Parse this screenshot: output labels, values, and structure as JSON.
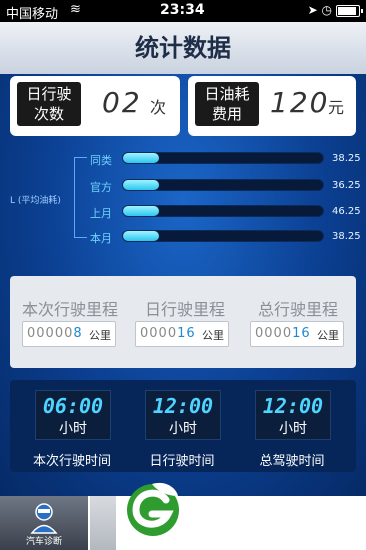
{
  "status_bar": {
    "carrier": "中国移动",
    "time": "23:34"
  },
  "title": "统计数据",
  "cards": {
    "daily_trips": {
      "label_line1": "日行驶",
      "label_line2": "次数",
      "value": "02",
      "unit": "次"
    },
    "daily_fuel": {
      "label_line1": "日油耗",
      "label_line2": "费用",
      "value": "120",
      "unit": "元"
    }
  },
  "fuel_chart": {
    "axis_label": "L (平均油耗)",
    "bars": [
      {
        "label": "同类",
        "value": "38.25",
        "fill": 0.18
      },
      {
        "label": "官方",
        "value": "36.25",
        "fill": 0.18
      },
      {
        "label": "上月",
        "value": "46.25",
        "fill": 0.18
      },
      {
        "label": "本月",
        "value": "38.25",
        "fill": 0.18
      }
    ]
  },
  "mileage": {
    "unit": "公里",
    "items": [
      {
        "title": "本次行驶里程",
        "prefix": "00000",
        "digits": "8"
      },
      {
        "title": "日行驶里程",
        "prefix": "0000",
        "digits": "16"
      },
      {
        "title": "总行驶里程",
        "prefix": "0000",
        "digits": "16"
      }
    ]
  },
  "times": {
    "unit": "小时",
    "items": [
      {
        "value": "06:00",
        "label": "本次行驶时间"
      },
      {
        "value": "12:00",
        "label": "日行驶时间"
      },
      {
        "value": "12:00",
        "label": "总驾驶时间"
      }
    ]
  },
  "tabbar": {
    "diagnosis_label": "汽车诊断"
  },
  "colors": {
    "accent": "#2cc6f0",
    "panel": "#062659",
    "logo_green": "#2f9c2f"
  }
}
